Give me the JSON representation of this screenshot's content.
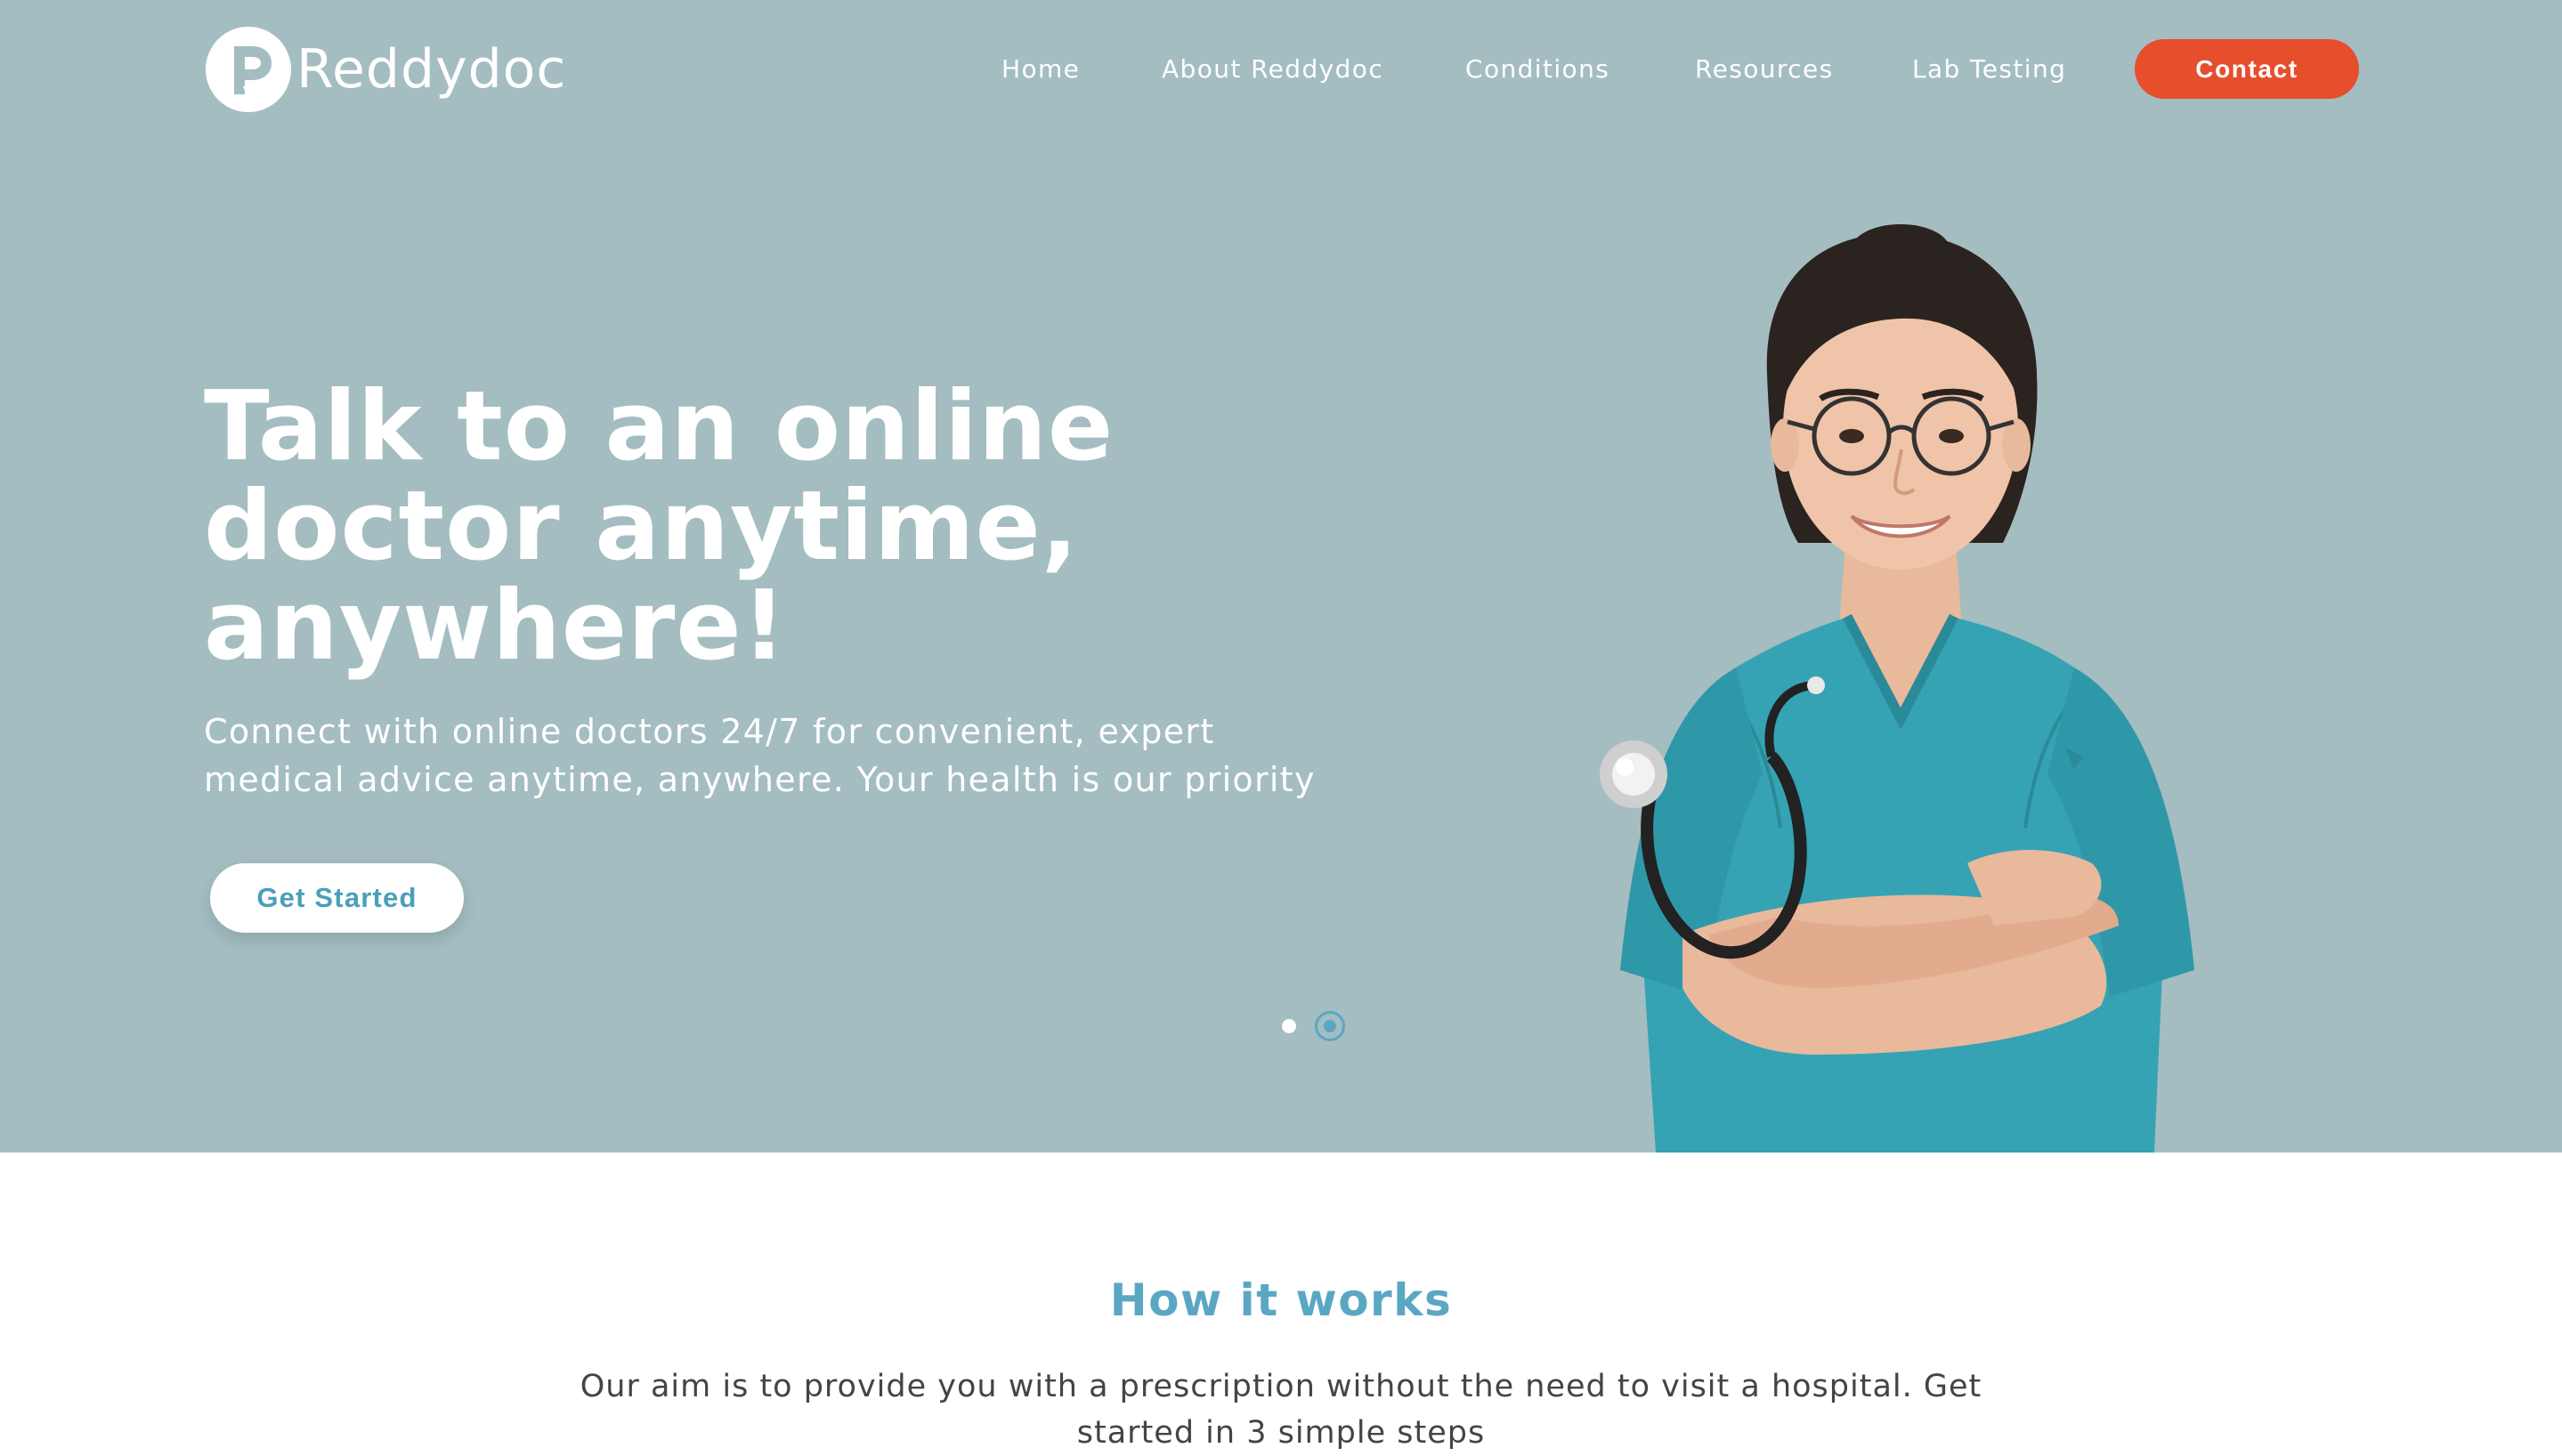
{
  "brand": {
    "name": "Reddydoc"
  },
  "nav": {
    "items": [
      {
        "label": "Home"
      },
      {
        "label": "About Reddydoc"
      },
      {
        "label": "Conditions"
      },
      {
        "label": "Resources"
      },
      {
        "label": "Lab Testing"
      }
    ],
    "contact_label": "Contact"
  },
  "hero": {
    "title_line1": "Talk to an online",
    "title_line2": "doctor anytime,",
    "title_line3": "anywhere!",
    "subtitle": "Connect with online doctors 24/7 for convenient, expert medical advice anytime, anywhere. Your health is our priority",
    "cta_label": "Get Started",
    "slider": {
      "slides": 2,
      "active": 2
    }
  },
  "how_it_works": {
    "title": "How it works",
    "text": "Our aim is to provide you with a prescription without the need to visit a hospital. Get started in 3 simple steps"
  },
  "colors": {
    "hero_bg": "#a4bdc1",
    "accent": "#e64e2c",
    "brand_blue": "#5aa7c4",
    "scrubs": "#35a3b3"
  }
}
